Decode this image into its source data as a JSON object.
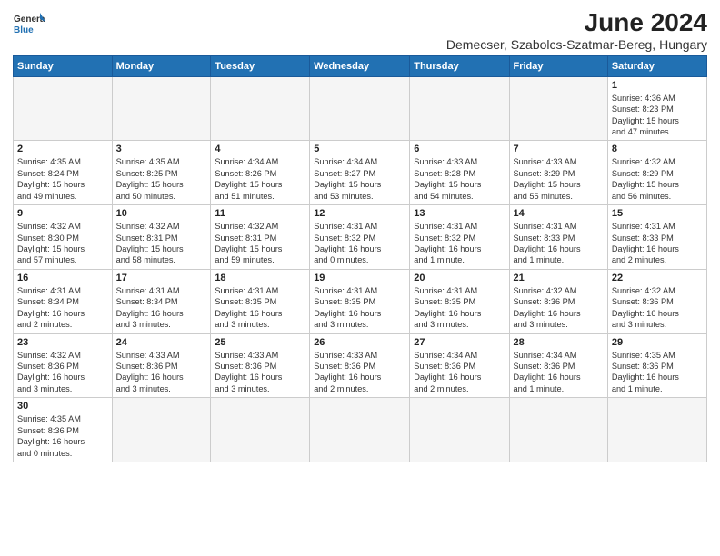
{
  "logo": {
    "line1": "General",
    "line2": "Blue"
  },
  "title": "June 2024",
  "subtitle": "Demecser, Szabolcs-Szatmar-Bereg, Hungary",
  "days_of_week": [
    "Sunday",
    "Monday",
    "Tuesday",
    "Wednesday",
    "Thursday",
    "Friday",
    "Saturday"
  ],
  "weeks": [
    [
      {
        "day": "",
        "info": ""
      },
      {
        "day": "",
        "info": ""
      },
      {
        "day": "",
        "info": ""
      },
      {
        "day": "",
        "info": ""
      },
      {
        "day": "",
        "info": ""
      },
      {
        "day": "",
        "info": ""
      },
      {
        "day": "1",
        "info": "Sunrise: 4:36 AM\nSunset: 8:23 PM\nDaylight: 15 hours\nand 47 minutes."
      }
    ],
    [
      {
        "day": "2",
        "info": "Sunrise: 4:35 AM\nSunset: 8:24 PM\nDaylight: 15 hours\nand 49 minutes."
      },
      {
        "day": "3",
        "info": "Sunrise: 4:35 AM\nSunset: 8:25 PM\nDaylight: 15 hours\nand 50 minutes."
      },
      {
        "day": "4",
        "info": "Sunrise: 4:34 AM\nSunset: 8:26 PM\nDaylight: 15 hours\nand 51 minutes."
      },
      {
        "day": "5",
        "info": "Sunrise: 4:34 AM\nSunset: 8:27 PM\nDaylight: 15 hours\nand 53 minutes."
      },
      {
        "day": "6",
        "info": "Sunrise: 4:33 AM\nSunset: 8:28 PM\nDaylight: 15 hours\nand 54 minutes."
      },
      {
        "day": "7",
        "info": "Sunrise: 4:33 AM\nSunset: 8:29 PM\nDaylight: 15 hours\nand 55 minutes."
      },
      {
        "day": "8",
        "info": "Sunrise: 4:32 AM\nSunset: 8:29 PM\nDaylight: 15 hours\nand 56 minutes."
      }
    ],
    [
      {
        "day": "9",
        "info": "Sunrise: 4:32 AM\nSunset: 8:30 PM\nDaylight: 15 hours\nand 57 minutes."
      },
      {
        "day": "10",
        "info": "Sunrise: 4:32 AM\nSunset: 8:31 PM\nDaylight: 15 hours\nand 58 minutes."
      },
      {
        "day": "11",
        "info": "Sunrise: 4:32 AM\nSunset: 8:31 PM\nDaylight: 15 hours\nand 59 minutes."
      },
      {
        "day": "12",
        "info": "Sunrise: 4:31 AM\nSunset: 8:32 PM\nDaylight: 16 hours\nand 0 minutes."
      },
      {
        "day": "13",
        "info": "Sunrise: 4:31 AM\nSunset: 8:32 PM\nDaylight: 16 hours\nand 1 minute."
      },
      {
        "day": "14",
        "info": "Sunrise: 4:31 AM\nSunset: 8:33 PM\nDaylight: 16 hours\nand 1 minute."
      },
      {
        "day": "15",
        "info": "Sunrise: 4:31 AM\nSunset: 8:33 PM\nDaylight: 16 hours\nand 2 minutes."
      }
    ],
    [
      {
        "day": "16",
        "info": "Sunrise: 4:31 AM\nSunset: 8:34 PM\nDaylight: 16 hours\nand 2 minutes."
      },
      {
        "day": "17",
        "info": "Sunrise: 4:31 AM\nSunset: 8:34 PM\nDaylight: 16 hours\nand 3 minutes."
      },
      {
        "day": "18",
        "info": "Sunrise: 4:31 AM\nSunset: 8:35 PM\nDaylight: 16 hours\nand 3 minutes."
      },
      {
        "day": "19",
        "info": "Sunrise: 4:31 AM\nSunset: 8:35 PM\nDaylight: 16 hours\nand 3 minutes."
      },
      {
        "day": "20",
        "info": "Sunrise: 4:31 AM\nSunset: 8:35 PM\nDaylight: 16 hours\nand 3 minutes."
      },
      {
        "day": "21",
        "info": "Sunrise: 4:32 AM\nSunset: 8:36 PM\nDaylight: 16 hours\nand 3 minutes."
      },
      {
        "day": "22",
        "info": "Sunrise: 4:32 AM\nSunset: 8:36 PM\nDaylight: 16 hours\nand 3 minutes."
      }
    ],
    [
      {
        "day": "23",
        "info": "Sunrise: 4:32 AM\nSunset: 8:36 PM\nDaylight: 16 hours\nand 3 minutes."
      },
      {
        "day": "24",
        "info": "Sunrise: 4:33 AM\nSunset: 8:36 PM\nDaylight: 16 hours\nand 3 minutes."
      },
      {
        "day": "25",
        "info": "Sunrise: 4:33 AM\nSunset: 8:36 PM\nDaylight: 16 hours\nand 3 minutes."
      },
      {
        "day": "26",
        "info": "Sunrise: 4:33 AM\nSunset: 8:36 PM\nDaylight: 16 hours\nand 2 minutes."
      },
      {
        "day": "27",
        "info": "Sunrise: 4:34 AM\nSunset: 8:36 PM\nDaylight: 16 hours\nand 2 minutes."
      },
      {
        "day": "28",
        "info": "Sunrise: 4:34 AM\nSunset: 8:36 PM\nDaylight: 16 hours\nand 1 minute."
      },
      {
        "day": "29",
        "info": "Sunrise: 4:35 AM\nSunset: 8:36 PM\nDaylight: 16 hours\nand 1 minute."
      }
    ],
    [
      {
        "day": "30",
        "info": "Sunrise: 4:35 AM\nSunset: 8:36 PM\nDaylight: 16 hours\nand 0 minutes."
      },
      {
        "day": "",
        "info": ""
      },
      {
        "day": "",
        "info": ""
      },
      {
        "day": "",
        "info": ""
      },
      {
        "day": "",
        "info": ""
      },
      {
        "day": "",
        "info": ""
      },
      {
        "day": "",
        "info": ""
      }
    ]
  ]
}
